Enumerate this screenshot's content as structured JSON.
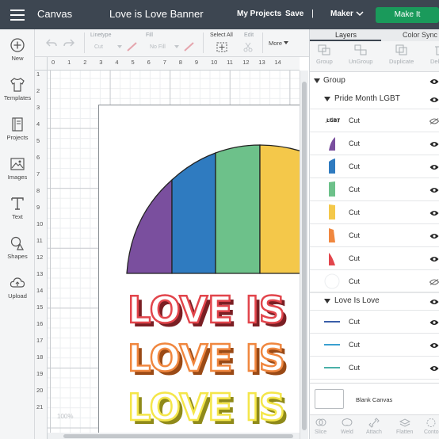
{
  "header": {
    "app_title": "Canvas",
    "project_title": "Love is Love Banner",
    "my_projects": "My Projects",
    "save": "Save",
    "separator": "|",
    "machine": "Maker",
    "make_it": "Make It",
    "accent_color": "#1a9a5b"
  },
  "sidebar": {
    "items": [
      {
        "label": "New",
        "icon": "plus-circle-icon"
      },
      {
        "label": "Templates",
        "icon": "shirt-icon"
      },
      {
        "label": "Projects",
        "icon": "book-icon"
      },
      {
        "label": "Images",
        "icon": "image-icon"
      },
      {
        "label": "Text",
        "icon": "text-t-icon"
      },
      {
        "label": "Shapes",
        "icon": "shapes-icon"
      },
      {
        "label": "Upload",
        "icon": "cloud-upload-icon"
      }
    ]
  },
  "toolbar": {
    "linetype_label": "Linetype",
    "linetype_value": "Cut",
    "fill_label": "Fill",
    "fill_value": "No Fill",
    "select_all": "Select All",
    "edit": "Edit",
    "more": "More"
  },
  "rulers": {
    "top": [
      "0",
      "1",
      "2",
      "3",
      "4",
      "5",
      "6",
      "7",
      "8",
      "9",
      "10",
      "11",
      "12",
      "13",
      "14"
    ],
    "left": [
      "1",
      "2",
      "3",
      "4",
      "5",
      "6",
      "7",
      "8",
      "9",
      "10",
      "11",
      "12",
      "13",
      "14",
      "15",
      "16",
      "17",
      "18",
      "19",
      "20",
      "21"
    ]
  },
  "canvas": {
    "zoom": "100%",
    "rainbow_colors": [
      "#7a4f9e",
      "#2f7bc0",
      "#6dc18a",
      "#f4c84a"
    ],
    "text_lines": [
      {
        "text": "LOVE IS LOVE",
        "color": "#e2454c"
      },
      {
        "text": "LOVE IS LOVE",
        "color": "#f0873f"
      },
      {
        "text": "LOVE IS LOVE",
        "color": "#f4e64a"
      }
    ]
  },
  "layers_panel": {
    "tabs": [
      "Layers",
      "Color Sync"
    ],
    "tools": [
      "Group",
      "UnGroup",
      "Duplicate",
      "Delete"
    ],
    "group_label": "Group",
    "subgroup_1": "Pride Month LGBT",
    "subgroup_1_items": [
      {
        "label": "Cut",
        "swatch": "lgbt-text",
        "hidden": true
      },
      {
        "label": "Cut",
        "swatch": "#7a4f9e"
      },
      {
        "label": "Cut",
        "swatch": "#2f7bc0"
      },
      {
        "label": "Cut",
        "swatch": "#6dc18a"
      },
      {
        "label": "Cut",
        "swatch": "#f4c84a"
      },
      {
        "label": "Cut",
        "swatch": "#f0873f"
      },
      {
        "label": "Cut",
        "swatch": "#e2454c"
      },
      {
        "label": "Cut",
        "swatch": "#ffffff",
        "hidden": true
      }
    ],
    "subgroup_2": "Love Is Love",
    "subgroup_2_items": [
      {
        "label": "Cut",
        "swatch": "#3a5ea8"
      },
      {
        "label": "Cut",
        "swatch": "#3aa0d0"
      },
      {
        "label": "Cut",
        "swatch": "#4ab0a8"
      }
    ],
    "blank_canvas": "Blank Canvas",
    "bottom_tools": [
      "Slice",
      "Weld",
      "Attach",
      "Flatten",
      "Conto"
    ]
  }
}
